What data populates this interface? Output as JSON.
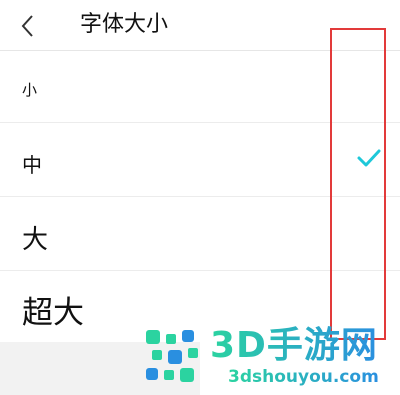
{
  "header": {
    "title": "字体大小",
    "back_icon": "chevron-left-icon"
  },
  "options": [
    {
      "label": "小",
      "selected": false
    },
    {
      "label": "中",
      "selected": true
    },
    {
      "label": "大",
      "selected": false
    },
    {
      "label": "超大",
      "selected": false
    }
  ],
  "check_icon": "checkmark-icon",
  "colors": {
    "accent": "#1ec8d9",
    "highlight_box": "#e23a3a",
    "watermark_green": "#2bd3a0",
    "watermark_blue": "#2a8fe0"
  },
  "watermark": {
    "big_text": "3D手游网",
    "small_text": "3dshouyou.com"
  }
}
